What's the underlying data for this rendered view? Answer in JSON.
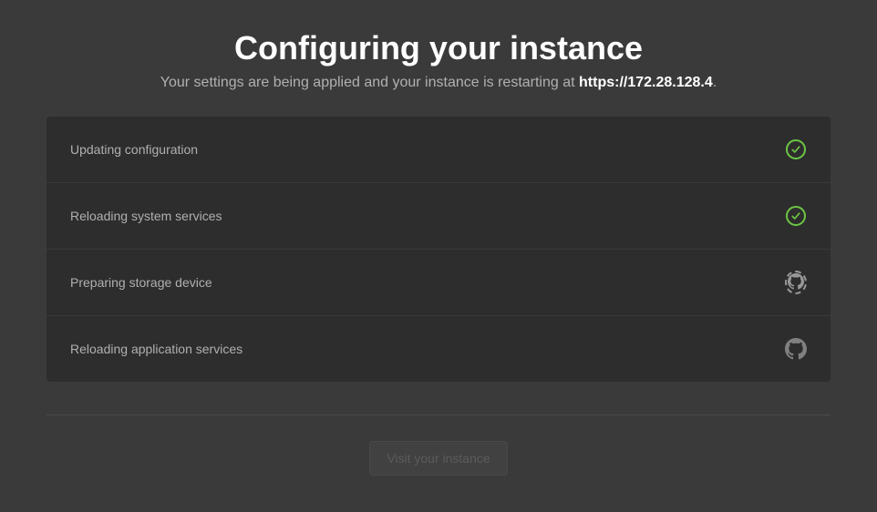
{
  "header": {
    "title": "Configuring your instance",
    "subtitle_prefix": "Your settings are being applied and your instance is restarting at ",
    "url": "https://172.28.128.4",
    "subtitle_suffix": "."
  },
  "steps": [
    {
      "label": "Updating configuration",
      "status": "done"
    },
    {
      "label": "Reloading system services",
      "status": "done"
    },
    {
      "label": "Preparing storage device",
      "status": "in-progress"
    },
    {
      "label": "Reloading application services",
      "status": "pending"
    }
  ],
  "button": {
    "label": "Visit your instance"
  }
}
